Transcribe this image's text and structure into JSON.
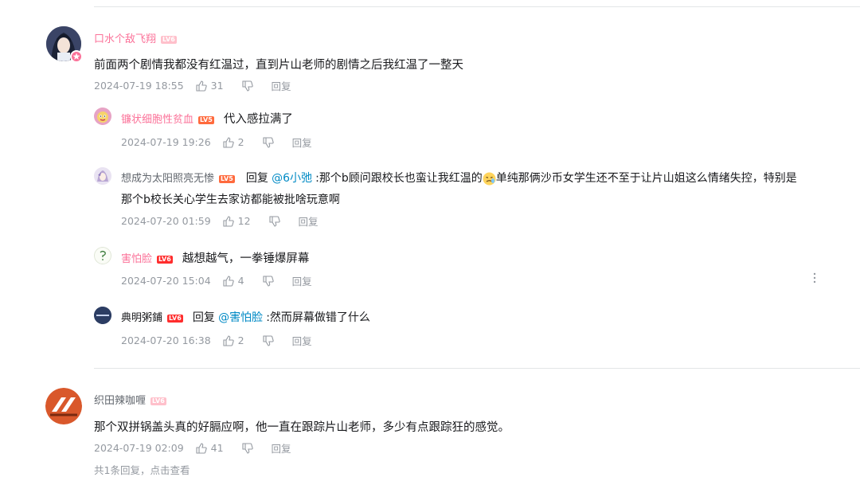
{
  "comments": [
    {
      "user": "口水个敌飞翔",
      "level": "LV6",
      "text": "前面两个剧情我都没有红温过，直到片山老师的剧情之后我红温了一整天",
      "time": "2024-07-19 18:55",
      "likes": "31",
      "reply": "回复"
    },
    {
      "user": "织田辣咖喱",
      "level": "LV6",
      "text": "那个双拼锅盖头真的好膈应啊，他一直在跟踪片山老师，多少有点跟踪狂的感觉。",
      "time": "2024-07-19 02:09",
      "likes": "41",
      "reply": "回复",
      "more_replies": "共1条回复，点击查看"
    }
  ],
  "replies": [
    {
      "user": "镰状细胞性贫血",
      "level": "LV5",
      "text": "代入感拉满了",
      "time": "2024-07-19 19:26",
      "likes": "2",
      "reply": "回复"
    },
    {
      "user": "想成为太阳照亮无惨",
      "level": "LV5",
      "reply_word": "回复",
      "mention": "@6小弛",
      "text1": ":那个b顾问跟校长也蛮让我红温的",
      "text2": "单纯那俩沙币女学生还不至于让片山姐这么情绪失控，特别是",
      "text3": "那个b校长关心学生去家访都能被批啥玩意啊",
      "time": "2024-07-20 01:59",
      "likes": "12",
      "reply": "回复"
    },
    {
      "user": "害怕脸",
      "level": "LV6",
      "text": "越想越气，一拳锤爆屏幕",
      "time": "2024-07-20 15:04",
      "likes": "4",
      "reply": "回复"
    },
    {
      "user": "典明粥鋪",
      "level": "LV6",
      "reply_word": "回复",
      "mention": "@害怕脸",
      "text": ":然而屏幕做错了什么",
      "time": "2024-07-20 16:38",
      "likes": "2",
      "reply": "回复"
    }
  ],
  "colors": {
    "pink": "#fb7299",
    "gray": "#9499a0",
    "link": "#008ac5"
  },
  "icons": [
    "thumb-up-icon",
    "thumb-down-icon",
    "more-icon",
    "emoji-icon"
  ]
}
